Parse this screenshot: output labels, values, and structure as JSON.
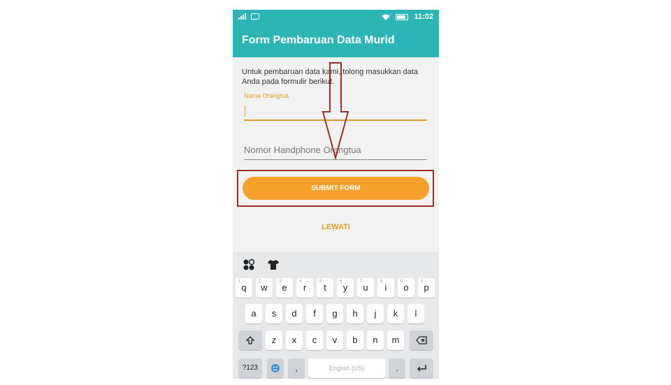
{
  "status_bar": {
    "time": "11:02"
  },
  "app_bar": {
    "title": "Form Pembaruan Data Murid"
  },
  "form": {
    "intro": "Untuk pembaruan data kami, tolong masukkan data Anda pada formulir berikut.",
    "parent_name_label": "Nama Orangtua",
    "parent_phone_placeholder": "Nomor Handphone Orangtua",
    "submit_label": "SUBMIT FORM",
    "skip_label": "LEWATI"
  },
  "keyboard": {
    "row1": [
      "q",
      "w",
      "e",
      "r",
      "t",
      "y",
      "u",
      "i",
      "o",
      "p"
    ],
    "row1_hints": [
      "1",
      "2",
      "3",
      "4",
      "5",
      "6",
      "7",
      "8",
      "9",
      "0"
    ],
    "row2": [
      "a",
      "s",
      "d",
      "f",
      "g",
      "h",
      "j",
      "k",
      "l"
    ],
    "row3": [
      "z",
      "x",
      "c",
      "v",
      "b",
      "n",
      "m"
    ],
    "symbols_label": "?123",
    "comma": ",",
    "period": ".",
    "space_label": "English (US)"
  },
  "colors": {
    "accent": "#2db5b5",
    "button": "#f5a02a",
    "highlight": "#e39b1f",
    "annotation": "#9e2a2a"
  }
}
